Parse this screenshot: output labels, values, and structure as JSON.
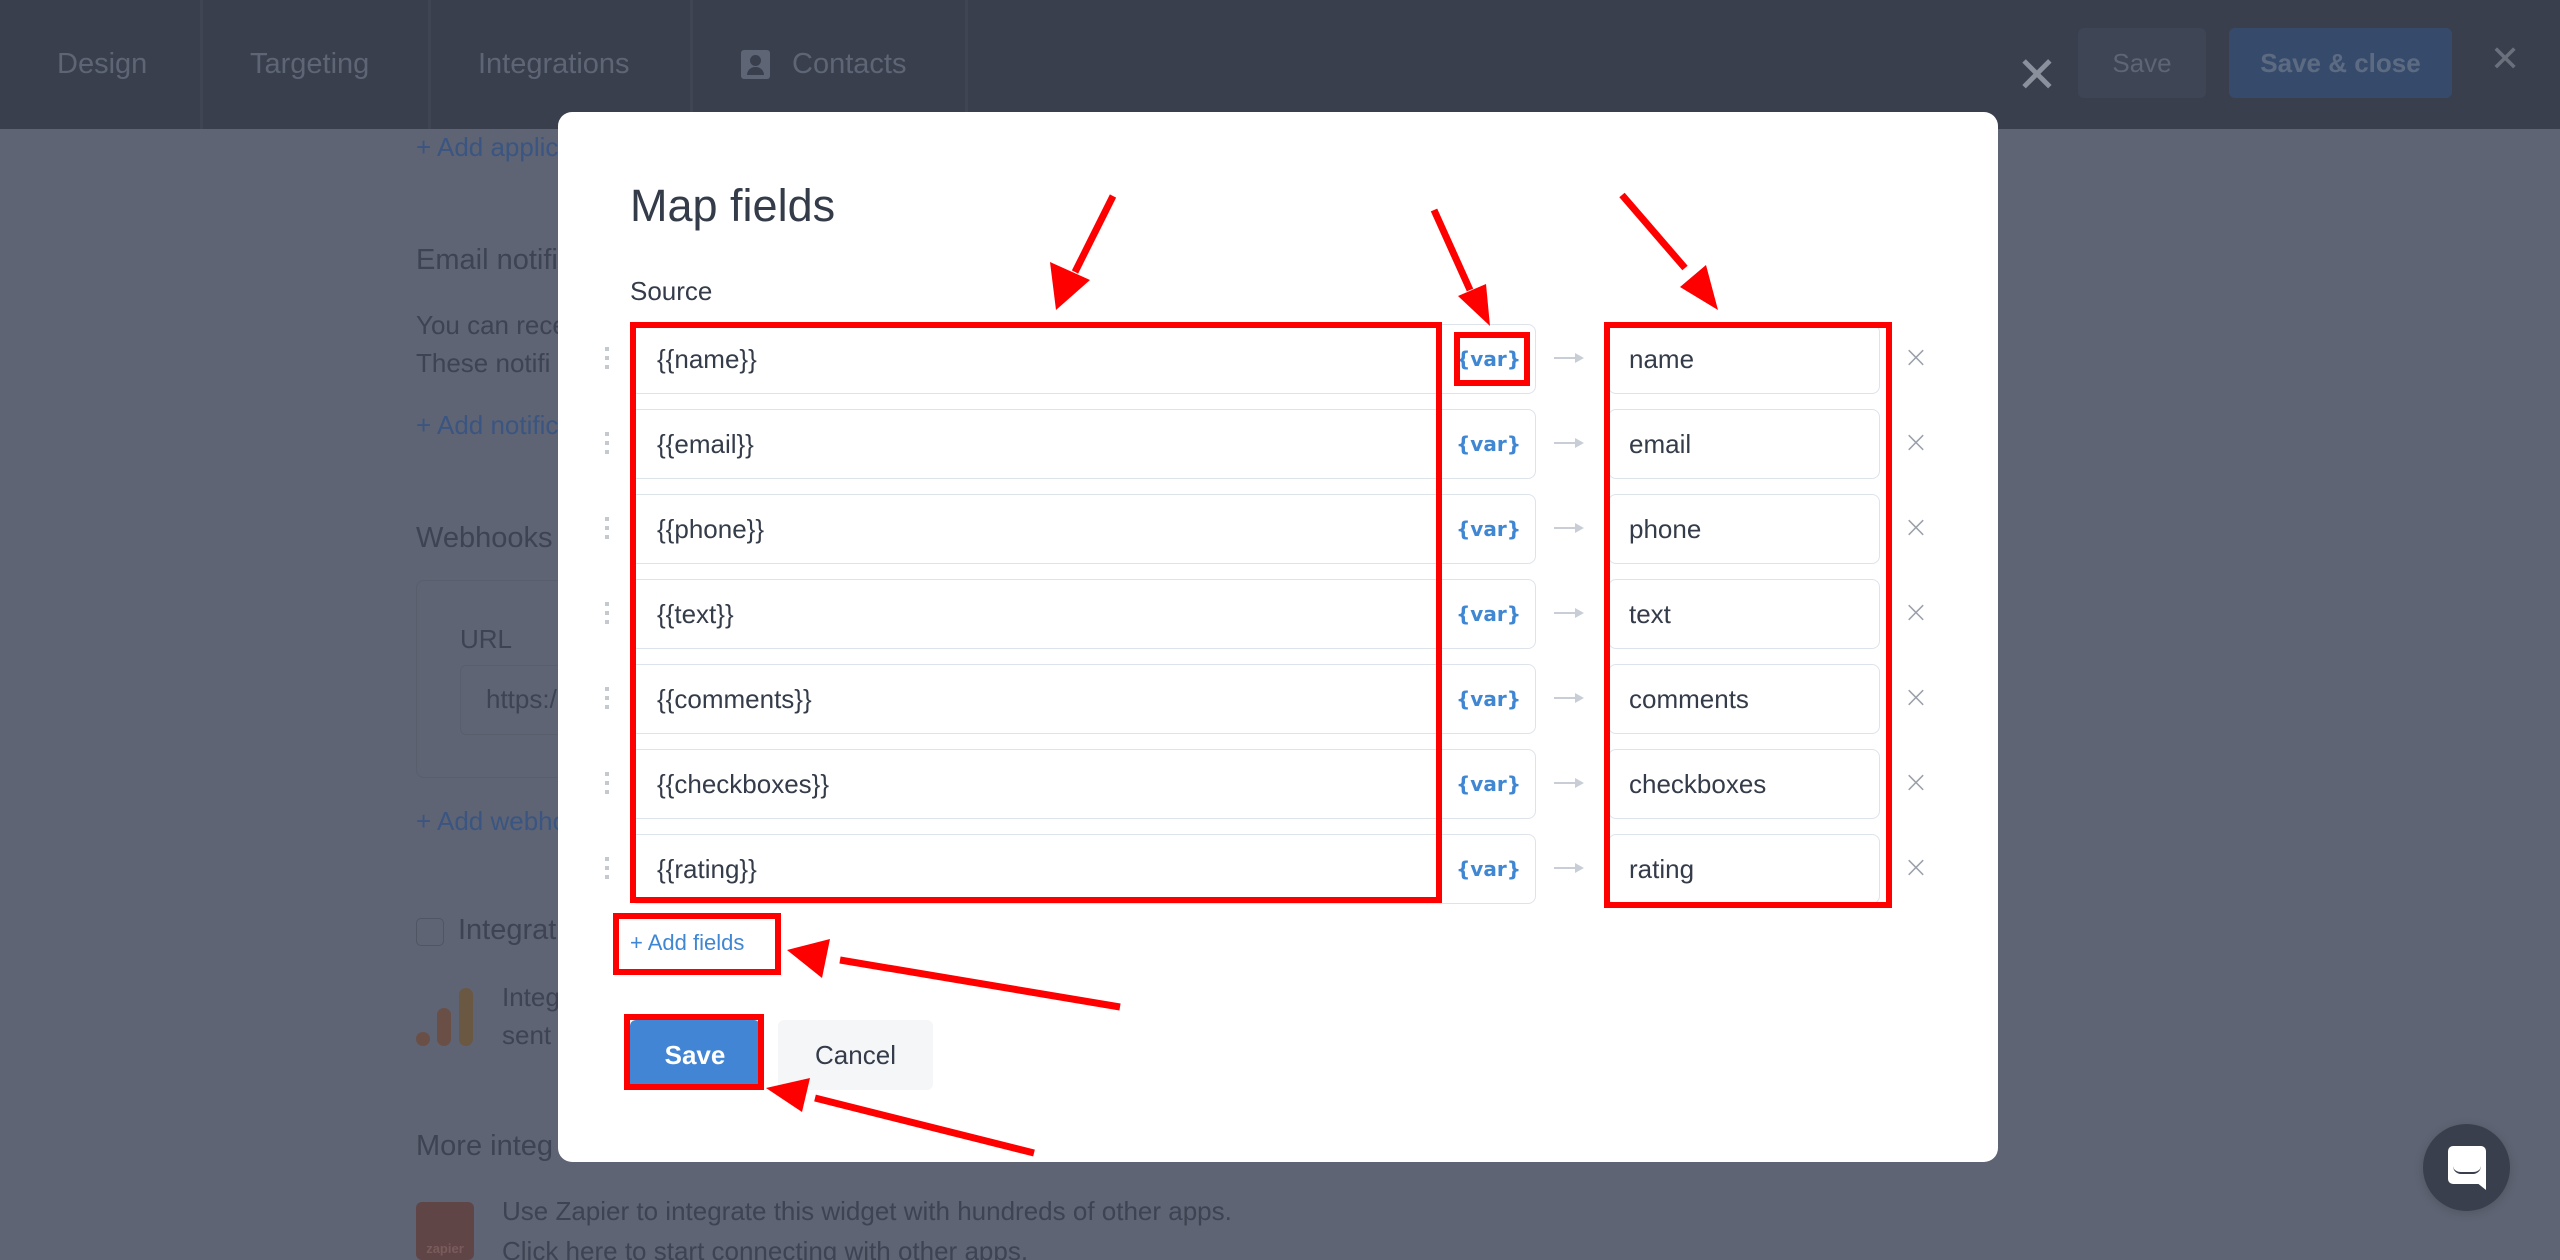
{
  "topbar": {
    "tabs": [
      {
        "label": "Design"
      },
      {
        "label": "Targeting"
      },
      {
        "label": "Integrations"
      },
      {
        "label": "Contacts",
        "icon": "contact-icon"
      }
    ],
    "save_label": "Save",
    "save_close_label": "Save & close",
    "close_icon": "close-icon"
  },
  "background": {
    "add_application_link": "+ Add applic",
    "email_heading": "Email notifi",
    "email_desc_1": "You can rece",
    "email_desc_2": "These notifi",
    "add_notification_link": "+ Add notific",
    "webhooks_heading": "Webhooks",
    "url_label": "URL",
    "url_value": "https:/",
    "add_webhook_link": "+ Add webho",
    "integration_checkbox_label": "Integrat",
    "integration_desc_1": "Integ",
    "integration_desc_2": "sent",
    "more_integrations_heading": "More integ",
    "zapier_logo_text": "zapier",
    "zapier_desc_1": "Use Zapier to integrate this widget with hundreds of other apps.",
    "zapier_desc_2": "Click here to start connecting with other apps."
  },
  "modal": {
    "title": "Map fields",
    "source_label": "Source",
    "var_label": "{var}",
    "remove_icon": "×",
    "rows": [
      {
        "source": "{{name}}",
        "target": "name"
      },
      {
        "source": "{{email}}",
        "target": "email"
      },
      {
        "source": "{{phone}}",
        "target": "phone"
      },
      {
        "source": "{{text}}",
        "target": "text"
      },
      {
        "source": "{{comments}}",
        "target": "comments"
      },
      {
        "source": "{{checkboxes}}",
        "target": "checkboxes"
      },
      {
        "source": "{{rating}}",
        "target": "rating"
      }
    ],
    "add_fields_label": "+ Add fields",
    "save_label": "Save",
    "cancel_label": "Cancel"
  },
  "colors": {
    "accent": "#4285d4",
    "annotation": "#ff0000",
    "overlay": "#5e6473",
    "topbar": "#393f4d"
  }
}
